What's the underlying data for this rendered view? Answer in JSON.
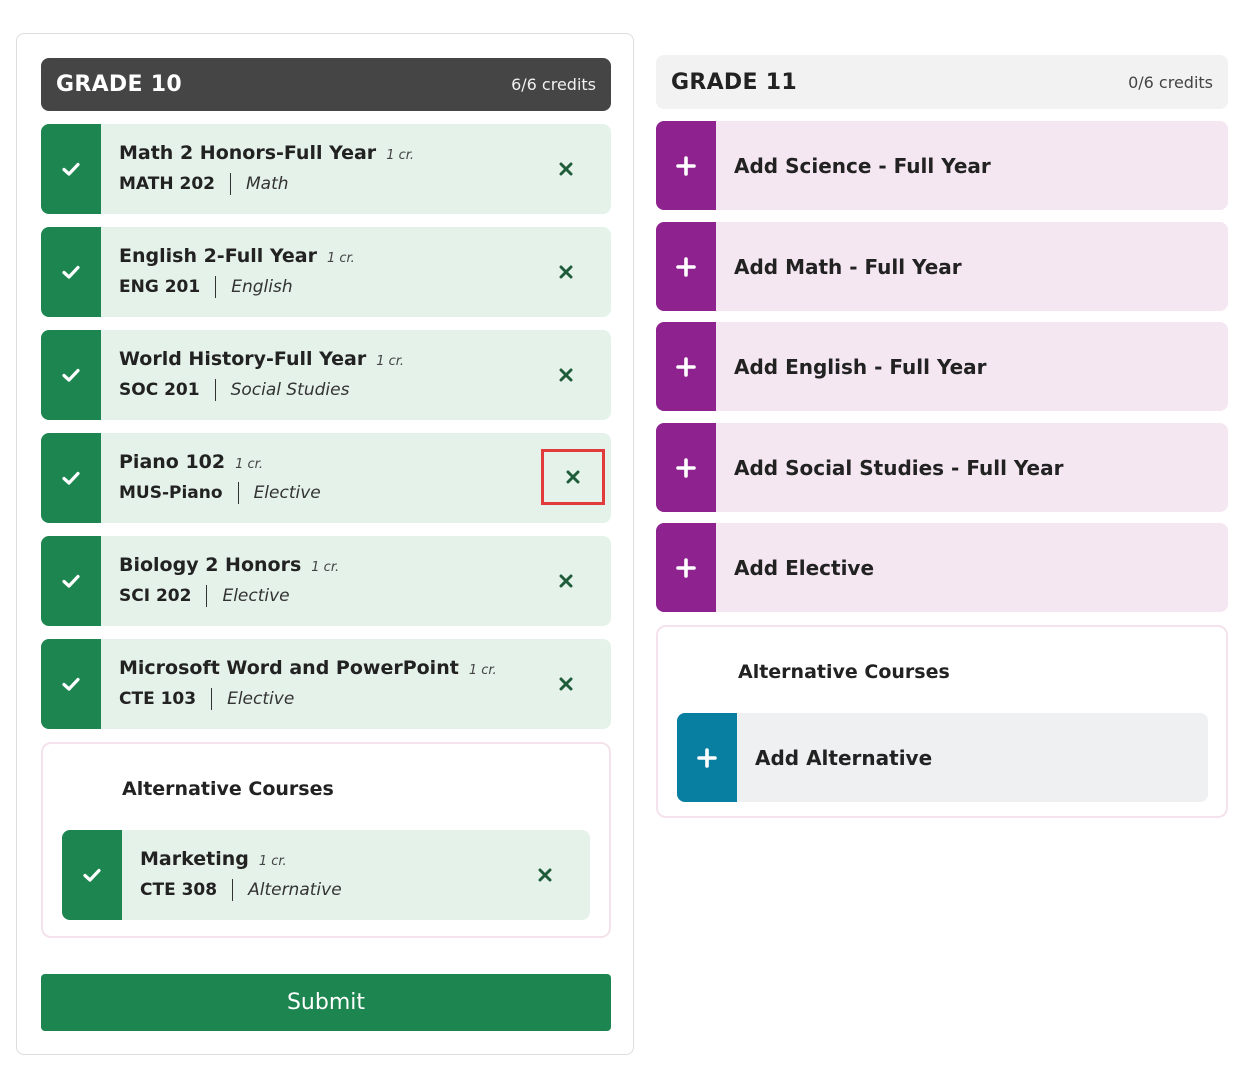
{
  "grade10": {
    "title": "GRADE 10",
    "credits": "6/6 credits",
    "courses": [
      {
        "name": "Math 2 Honors-Full Year",
        "cr": "1 cr.",
        "code": "MATH 202",
        "subject": "Math"
      },
      {
        "name": "English 2-Full Year",
        "cr": "1 cr.",
        "code": "ENG 201",
        "subject": "English"
      },
      {
        "name": "World History-Full Year",
        "cr": "1 cr.",
        "code": "SOC 201",
        "subject": "Social Studies"
      },
      {
        "name": "Piano 102",
        "cr": "1 cr.",
        "code": "MUS-Piano",
        "subject": "Elective"
      },
      {
        "name": "Biology 2 Honors",
        "cr": "1 cr.",
        "code": "SCI 202",
        "subject": "Elective"
      },
      {
        "name": "Microsoft Word and PowerPoint",
        "cr": "1 cr.",
        "code": "CTE 103",
        "subject": "Elective"
      }
    ],
    "alternatives": {
      "title": "Alternative Courses",
      "courses": [
        {
          "name": "Marketing",
          "cr": "1 cr.",
          "code": "CTE 308",
          "subject": "Alternative"
        }
      ]
    },
    "submit_label": "Submit"
  },
  "grade11": {
    "title": "GRADE 11",
    "credits": "0/6 credits",
    "add_items": [
      {
        "label": "Add Science - Full Year"
      },
      {
        "label": "Add Math - Full Year"
      },
      {
        "label": "Add English - Full Year"
      },
      {
        "label": "Add Social Studies - Full Year"
      },
      {
        "label": "Add Elective"
      }
    ],
    "alternatives": {
      "title": "Alternative Courses",
      "add_label": "Add Alternative"
    }
  },
  "colors": {
    "course_green": "#1d8550",
    "course_bg": "#e5f2ea",
    "add_purple": "#8e2390",
    "add_bg": "#f4e7f1",
    "alt_teal": "#087ea0",
    "header_dark": "#454545",
    "highlight_red": "#e23b3b"
  },
  "icons": {
    "course_status": "check-icon",
    "course_remove": "x-icon",
    "add": "plus-icon"
  },
  "highlighted_element": "remove-button for Piano 102"
}
